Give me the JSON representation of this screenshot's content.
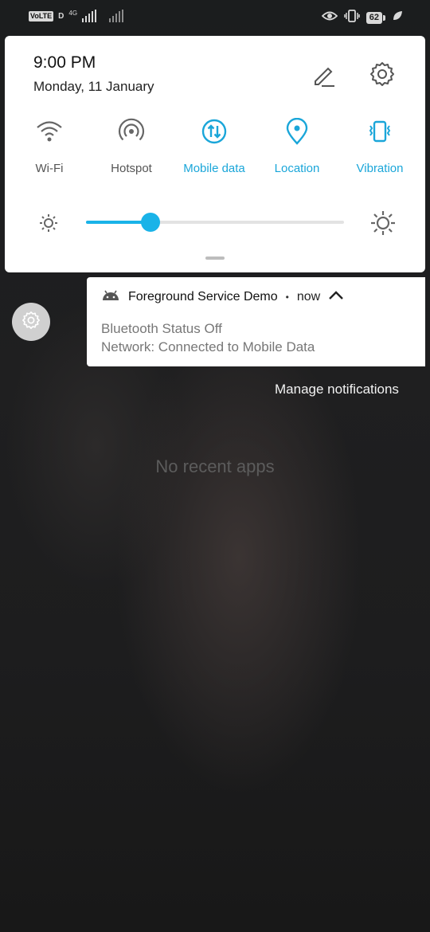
{
  "status_bar": {
    "volte": "VoLTE",
    "d_mark": "D",
    "network_type": "4G",
    "battery_level": "62",
    "icons": [
      "eye-comfort-icon",
      "vibrate-icon",
      "battery-icon",
      "leaf-icon"
    ]
  },
  "quick_settings": {
    "time": "9:00 PM",
    "date": "Monday, 11 January",
    "tiles": [
      {
        "label": "Wi-Fi",
        "icon": "wifi-icon",
        "active": false
      },
      {
        "label": "Hotspot",
        "icon": "hotspot-icon",
        "active": false
      },
      {
        "label": "Mobile data",
        "icon": "mobile-data-icon",
        "active": true
      },
      {
        "label": "Location",
        "icon": "location-icon",
        "active": true
      },
      {
        "label": "Vibration",
        "icon": "vibration-icon",
        "active": true
      }
    ],
    "brightness_level": 0.25,
    "colors": {
      "accent": "#1ab3e8",
      "inactive": "#555555"
    }
  },
  "notification": {
    "app_name": "Foreground Service Demo",
    "separator": "•",
    "time": "now",
    "line1": "Bluetooth Status Off",
    "line2": "Network: Connected to Mobile Data"
  },
  "manage_notifications": "Manage notifications",
  "recents_empty": "No recent apps"
}
